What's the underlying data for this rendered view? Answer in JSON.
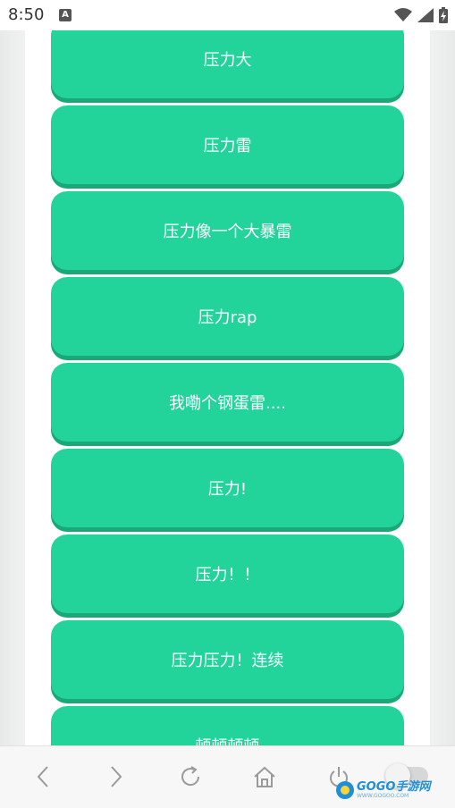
{
  "status_bar": {
    "time": "8:50",
    "notification_letter": "A"
  },
  "buttons": [
    {
      "label": "压力大"
    },
    {
      "label": "压力雷"
    },
    {
      "label": "压力像一个大暴雷"
    },
    {
      "label": "压力rap"
    },
    {
      "label": "我嘞个钢蛋雷...."
    },
    {
      "label": "压力!"
    },
    {
      "label": "压力！！"
    },
    {
      "label": "压力压力！连续"
    },
    {
      "label": "顿顿顿顿"
    }
  ],
  "toolbar": {
    "icons": [
      "back-icon",
      "forward-icon",
      "refresh-icon",
      "home-icon",
      "power-icon"
    ]
  },
  "watermark": {
    "main": "GOGO手游网",
    "sub": "WWW.GOGOO.COM"
  },
  "colors": {
    "button_bg": "#22d39a",
    "button_shadow": "#1aa876",
    "watermark_blue": "#1e90d8"
  }
}
